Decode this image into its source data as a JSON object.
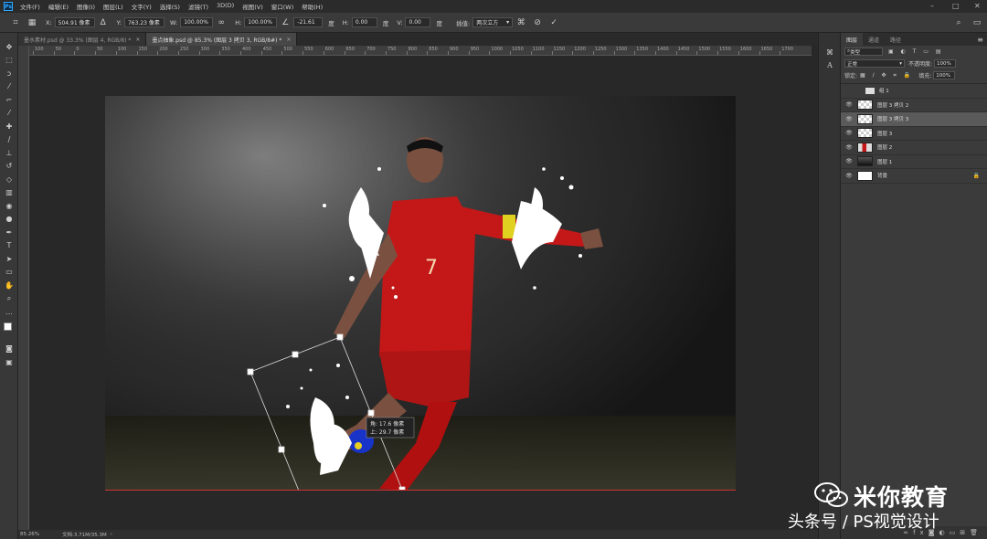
{
  "app": {
    "logo": "Ps"
  },
  "menu": [
    "文件(F)",
    "编辑(E)",
    "图像(I)",
    "图层(L)",
    "文字(Y)",
    "选择(S)",
    "滤镜(T)",
    "3D(D)",
    "视图(V)",
    "窗口(W)",
    "帮助(H)"
  ],
  "options": {
    "x_label": "X:",
    "x_value": "504.91 像素",
    "y_label": "Y:",
    "y_value": "763.23 像素",
    "w_label": "W:",
    "w_value": "100.00%",
    "h_label": "H:",
    "h_value": "100.00%",
    "angle_value": "-21.61",
    "hskew_label": "H:",
    "hskew_value": "0.00",
    "vskew_label": "V:",
    "vskew_value": "0.00",
    "degree_unit": "度",
    "interp_label": "插值:",
    "interp_value": "两次立方"
  },
  "doc_tabs": [
    {
      "label": "墨水素材.psd @ 33.3% (图层 4, RGB/8) *"
    },
    {
      "label": "墨点抽象.psd @ 85.3% (图层 3 拷贝 3, RGB/8#) *"
    }
  ],
  "ruler_labels": [
    "100",
    "50",
    "0",
    "50",
    "100",
    "150",
    "200",
    "250",
    "300",
    "350",
    "400",
    "450",
    "500",
    "550",
    "600",
    "650",
    "700",
    "750",
    "800",
    "850",
    "900",
    "950",
    "1000",
    "1050",
    "1100",
    "1150",
    "1200",
    "1250",
    "1300",
    "1350",
    "1400",
    "1450",
    "1500",
    "1550",
    "1600",
    "1650",
    "1700"
  ],
  "transform_readout": {
    "line1": "角: 17.6 像素",
    "line2": "上: 29.7 像素"
  },
  "status": {
    "zoom": "85.26%",
    "doc": "文档:3.71M/35.3M"
  },
  "panel": {
    "tabs": [
      "图层",
      "通道",
      "路径"
    ],
    "kind_label": "类型",
    "blend_mode": "正常",
    "opacity_label": "不透明度:",
    "opacity_value": "100%",
    "lock_label": "锁定:",
    "fill_label": "填充:",
    "fill_value": "100%",
    "layers": [
      {
        "name": "组 1",
        "type": "group"
      },
      {
        "name": "图层 3 拷贝 2",
        "type": "checker"
      },
      {
        "name": "图层 3 拷贝 3",
        "type": "checker",
        "selected": true
      },
      {
        "name": "图层 3",
        "type": "checker"
      },
      {
        "name": "图层 2",
        "type": "image"
      },
      {
        "name": "图层 1",
        "type": "dark"
      },
      {
        "name": "背景",
        "type": "white",
        "locked": true
      }
    ]
  },
  "watermark": {
    "title": "米你教育",
    "subtitle": "头条号 / PS视觉设计"
  },
  "colors": {
    "accent": "#31a8ff",
    "jersey": "#c41818",
    "ink": "#ffffff"
  }
}
